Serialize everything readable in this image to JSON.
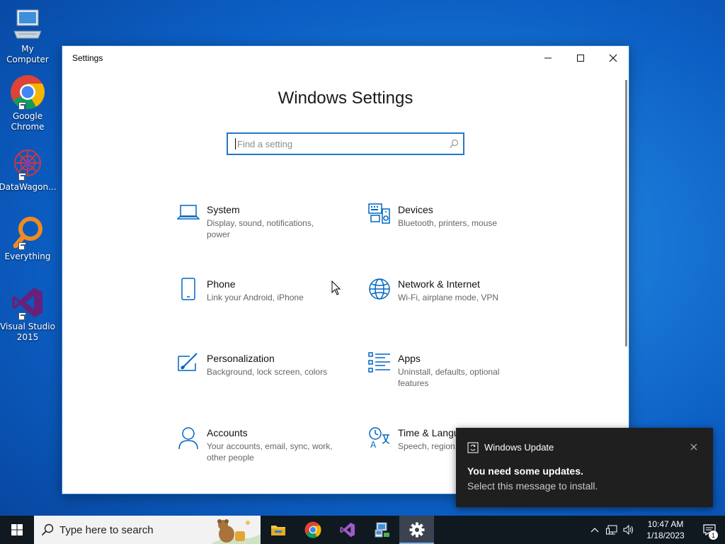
{
  "desktop": {
    "icons": [
      {
        "label": "My Computer",
        "icon": "computer-icon"
      },
      {
        "label": "Google Chrome",
        "icon": "chrome-icon"
      },
      {
        "label": "DataWagon...",
        "icon": "datawagon-icon"
      },
      {
        "label": "Everything",
        "icon": "everything-search-icon"
      },
      {
        "label": "Visual Studio 2015",
        "icon": "visual-studio-icon"
      }
    ]
  },
  "window": {
    "title": "Settings",
    "heading": "Windows Settings",
    "search_placeholder": "Find a setting",
    "accent": "#0067c0",
    "tiles": [
      {
        "name": "System",
        "desc": "Display, sound, notifications, power",
        "icon": "laptop-icon"
      },
      {
        "name": "Devices",
        "desc": "Bluetooth, printers, mouse",
        "icon": "keyboard-speaker-icon"
      },
      {
        "name": "Phone",
        "desc": "Link your Android, iPhone",
        "icon": "phone-icon"
      },
      {
        "name": "Network & Internet",
        "desc": "Wi-Fi, airplane mode, VPN",
        "icon": "globe-icon"
      },
      {
        "name": "Personalization",
        "desc": "Background, lock screen, colors",
        "icon": "paint-icon"
      },
      {
        "name": "Apps",
        "desc": "Uninstall, defaults, optional features",
        "icon": "apps-list-icon"
      },
      {
        "name": "Accounts",
        "desc": "Your accounts, email, sync, work, other people",
        "icon": "person-icon"
      },
      {
        "name": "Time & Langu",
        "desc": "Speech, region,",
        "icon": "time-language-icon"
      }
    ]
  },
  "toast": {
    "app": "Windows Update",
    "title": "You need some updates.",
    "body": "Select this message to install."
  },
  "taskbar": {
    "search_placeholder": "Type here to search",
    "apps": [
      "file-explorer-icon",
      "chrome-icon",
      "visual-studio-icon",
      "network-tool-icon",
      "settings-gear-icon"
    ],
    "time": "10:47 AM",
    "date": "1/18/2023",
    "notification_count": "1"
  }
}
